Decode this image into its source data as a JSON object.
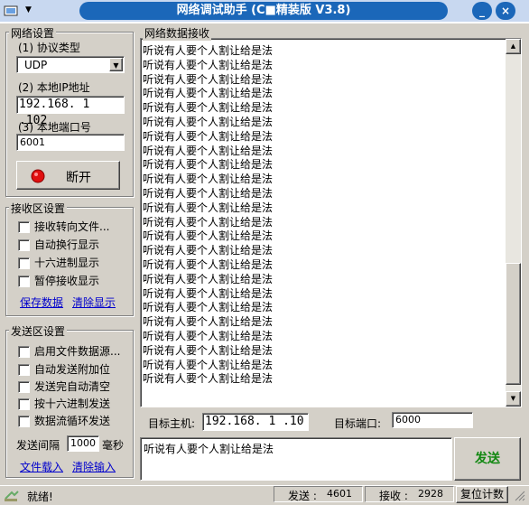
{
  "window": {
    "title": "网络调试助手 (C■精装版 V3.8)",
    "min_label": "_",
    "close_label": "×",
    "accent": "#1b67b9"
  },
  "network": {
    "group_title": "网络设置",
    "protocol_label": "(1) 协议类型",
    "protocol_value": "UDP",
    "ip_label": "(2) 本地IP地址",
    "ip_value": "192.168. 1 .102",
    "port_label": "(3) 本地端口号",
    "port_value": "6001",
    "disconnect_label": "断开"
  },
  "recv_settings": {
    "group_title": "接收区设置",
    "options": [
      "接收转向文件...",
      "自动换行显示",
      "十六进制显示",
      "暂停接收显示"
    ],
    "save_link": "保存数据",
    "clear_link": "清除显示"
  },
  "send_settings": {
    "group_title": "发送区设置",
    "options": [
      "启用文件数据源...",
      "自动发送附加位",
      "发送完自动清空",
      "按十六进制发送",
      "数据流循环发送"
    ],
    "interval_label": "发送间隔",
    "interval_value": "1000",
    "interval_unit": "毫秒",
    "load_link": "文件载入",
    "clear_link": "清除输入"
  },
  "receive": {
    "group_title": "网络数据接收",
    "line_text": "听说有人要个人割让给是法",
    "line_count": 24
  },
  "target": {
    "host_label": "目标主机:",
    "host_value": "192.168. 1 .10",
    "port_label": "目标端口:",
    "port_value": "6000"
  },
  "send": {
    "input_value": "听说有人要个人割让给是法",
    "button_label": "发送"
  },
  "status": {
    "ready": "就绪!",
    "sent_label": "发送 :",
    "sent_value": "4601",
    "recv_label": "接收 :",
    "recv_value": "2928",
    "reset_label": "复位计数"
  }
}
